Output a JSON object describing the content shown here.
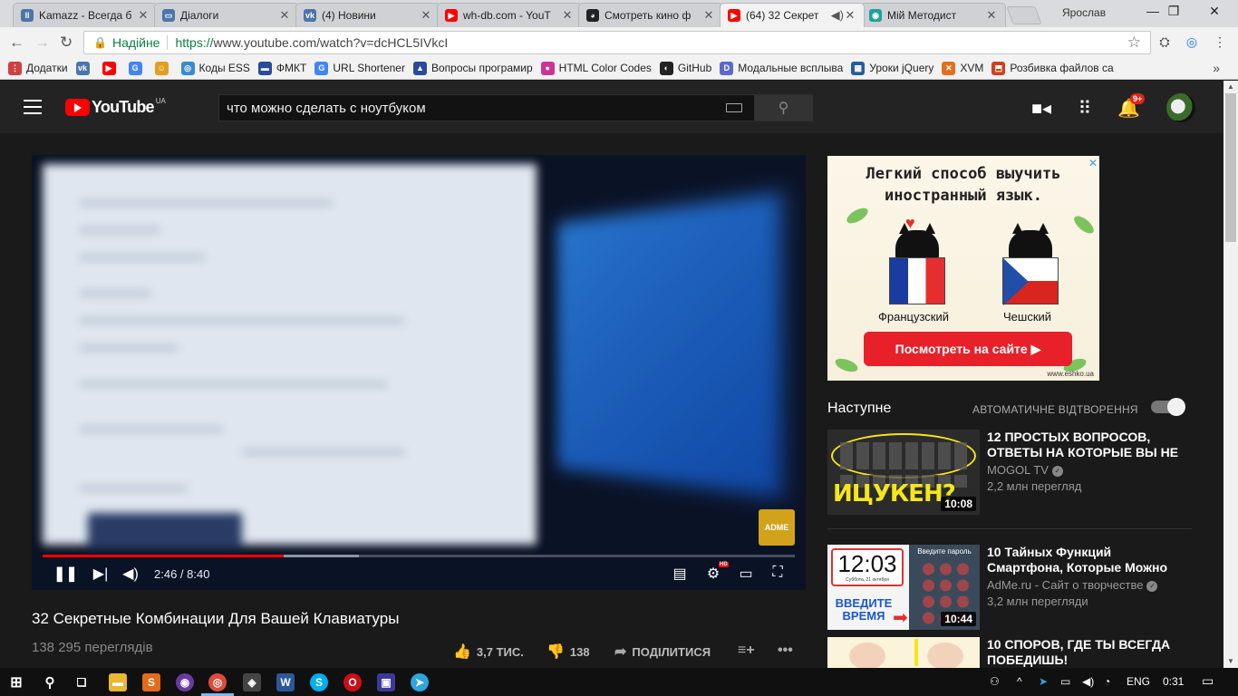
{
  "browser": {
    "tabs": [
      {
        "title": "Kamazz - Всегда б",
        "color": "#4a76a8",
        "glyph": "II"
      },
      {
        "title": "Діалоги",
        "color": "#4a76a8",
        "glyph": "▭"
      },
      {
        "title": "(4) Новини",
        "color": "#4a76a8",
        "glyph": "vk"
      },
      {
        "title": "wh-db.com - YouT",
        "color": "#ff0000",
        "glyph": "▶"
      },
      {
        "title": "Смотреть кино ф",
        "color": "#222222",
        "glyph": "◕"
      },
      {
        "title": "(64) 32 Секрет",
        "color": "#ff0000",
        "glyph": "▶"
      },
      {
        "title": "Мій Методист",
        "color": "#20a0a0",
        "glyph": "◉"
      }
    ],
    "profile_name": "Ярослав",
    "omnibox": {
      "secure_label": "Надійне",
      "url_scheme": "https://",
      "url_host": "www.youtube.com",
      "url_path": "/watch?v=dcHCL5IVkcI"
    },
    "bookmarks": [
      {
        "label": "Додатки",
        "color": "#d04040",
        "glyph": "⋮"
      },
      {
        "label": "",
        "color": "#4a76a8",
        "glyph": "vk"
      },
      {
        "label": "",
        "color": "#ff0000",
        "glyph": "▶"
      },
      {
        "label": "",
        "color": "#4285f4",
        "glyph": "G"
      },
      {
        "label": "",
        "color": "#e0a020",
        "glyph": "☺"
      },
      {
        "label": "Коды ESS",
        "color": "#3a8ad0",
        "glyph": "◎"
      },
      {
        "label": "ФМКТ",
        "color": "#2a4a9a",
        "glyph": "▬"
      },
      {
        "label": "URL Shortener",
        "color": "#4285f4",
        "glyph": "G"
      },
      {
        "label": "Вопросы програмир",
        "color": "#2a4a9a",
        "glyph": "▲"
      },
      {
        "label": "HTML Color Codes",
        "color": "#cc3399",
        "glyph": "●"
      },
      {
        "label": "GitHub",
        "color": "#222222",
        "glyph": "◐"
      },
      {
        "label": "Модальные всплыва",
        "color": "#5a6ad0",
        "glyph": "D"
      },
      {
        "label": "Уроки jQuery",
        "color": "#2a5aa0",
        "glyph": "▦"
      },
      {
        "label": "XVM",
        "color": "#e07020",
        "glyph": "✕"
      },
      {
        "label": "Розбивка файлов са",
        "color": "#d04020",
        "glyph": "⬒"
      }
    ],
    "bookmarks_more": "»"
  },
  "youtube": {
    "country": "UA",
    "logo_text": "YouTube",
    "search_value": "что можно сделать с ноутбуком",
    "notification_count": "9+",
    "player": {
      "time": "2:46 / 8:40",
      "progress": 0.32,
      "buffered": 0.42,
      "watermark": "ADME"
    },
    "video": {
      "title": "32 Секретные Комбинации Для Вашей Клавиатуры",
      "views": "138 295 переглядів",
      "likes": "3,7 ТИС.",
      "dislikes": "138",
      "share_label": "ПОДІЛИТИСЯ"
    },
    "ad": {
      "title_line1": "Легкий способ выучить",
      "title_line2": "иностранный язык.",
      "lang_left": "Французский",
      "lang_right": "Чешский",
      "button_label": "Посмотреть на сайте ▶",
      "site": "www.eshko.ua"
    },
    "up_next_label": "Наступне",
    "autoplay_label": "АВТОМАТИЧНЕ ВІДТВОРЕННЯ",
    "autoplay_on": true,
    "recommendations": [
      {
        "title": "12 ПРОСТЫХ ВОПРОСОВ, ОТВЕТЫ НА КОТОРЫЕ ВЫ НЕ",
        "channel": "MOGOL TV",
        "views": "2,2 млн перегляд",
        "duration": "10:08",
        "thumb_text": "ИЦУКЕН?"
      },
      {
        "title": "10 Тайных Функций Смартфона, Которые Можно",
        "channel": "AdMe.ru - Сайт о творчестве",
        "views": "3,2 млн перегляди",
        "duration": "10:44",
        "thumb_clock": "12:03",
        "thumb_date": "Суббота, 21 октября",
        "thumb_hint": "Введите пароль",
        "thumb_text": "ВВЕДИТЕ ВРЕМЯ"
      },
      {
        "title": "10 СПОРОВ, ГДЕ ТЫ ВСЕГДА ПОБЕДИШЬ!"
      }
    ]
  },
  "taskbar": {
    "lang": "ENG",
    "clock": "0:31"
  }
}
